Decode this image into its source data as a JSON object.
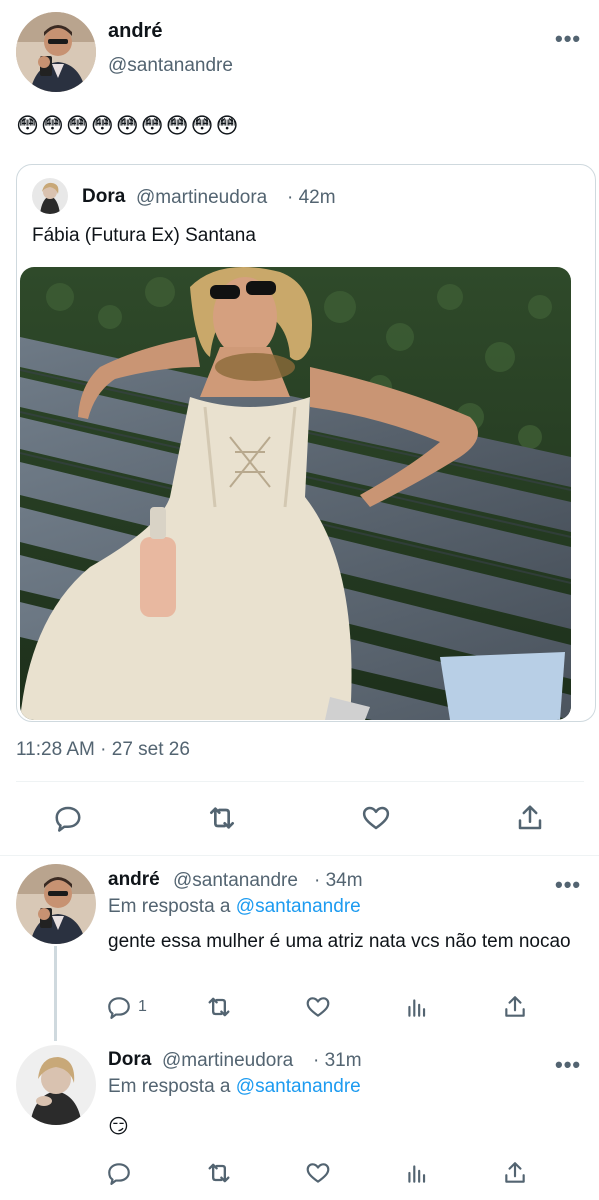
{
  "main_tweet": {
    "author_name": "andré",
    "author_handle": "@santanandre",
    "text": "😳😳😳😳😳😳😳😳😳",
    "timestamp": "11:28 AM · 27 set 26",
    "more_icon": "more-horizontal-icon"
  },
  "quoted_tweet": {
    "author_name": "Dora",
    "author_handle": "@martineudora",
    "time_ago": "· 42m",
    "text": "Fábia (Futura Ex) Santana",
    "image_icon": "photo-of-woman-on-bench"
  },
  "main_actions": {
    "reply_icon": "reply-icon",
    "retweet_icon": "retweet-icon",
    "like_icon": "like-icon",
    "share_icon": "share-icon"
  },
  "replies": [
    {
      "author_name": "andré",
      "author_handle": "@santanandre",
      "time_ago": "· 34m",
      "reply_to_prefix": "Em resposta a",
      "reply_to_handle": "@santanandre",
      "text": "gente essa mulher é uma atriz nata vcs não tem nocao",
      "reply_count": "1"
    },
    {
      "author_name": "Dora",
      "author_handle": "@martineudora",
      "time_ago": "· 31m",
      "reply_to_prefix": "Em resposta a",
      "reply_to_handle": "@santanandre",
      "text": "😏",
      "reply_count": ""
    }
  ],
  "colors": {
    "text_primary": "#0f1419",
    "text_secondary": "#536471",
    "link": "#1d9bf0",
    "divider": "#eff3f4"
  }
}
